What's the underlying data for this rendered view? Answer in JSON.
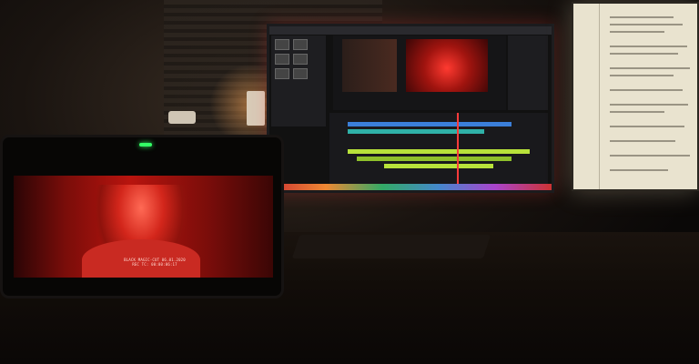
{
  "scene": {
    "description_tag": "editing-suite-photo",
    "accent_colors": {
      "screen_red": "#d3261b",
      "timeline_green": "#b8e23a",
      "timeline_blue": "#3b7fd9",
      "document_paper": "#e9e3cf"
    }
  },
  "field_monitor": {
    "caption_line1": "BLACK MAGIC-CUT 06.01.2020",
    "caption_line2": "REC TC: 00:00:06:17"
  }
}
